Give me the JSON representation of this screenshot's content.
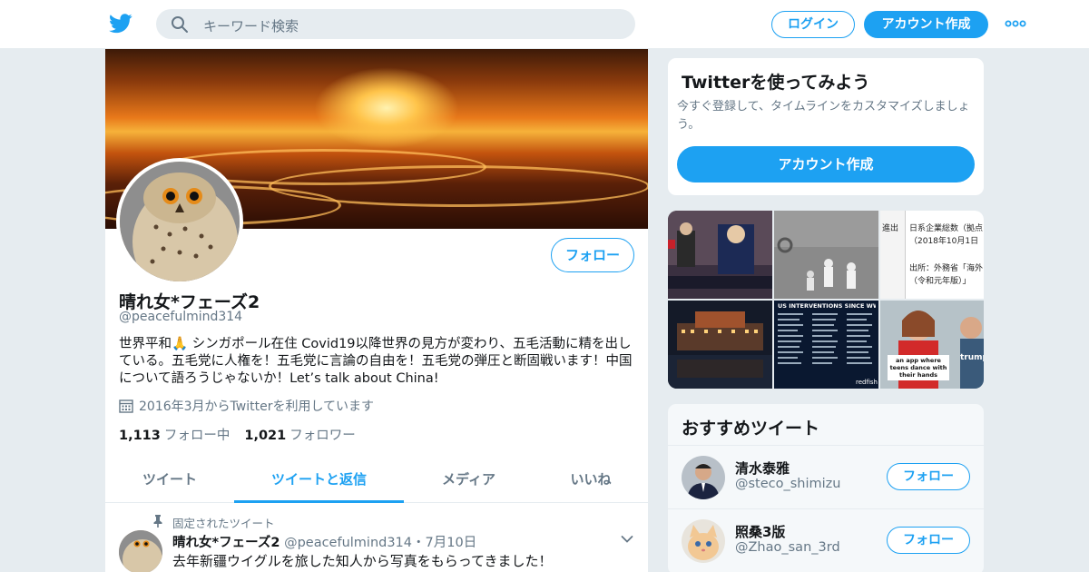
{
  "header": {
    "search_placeholder": "キーワード検索",
    "login_label": "ログイン",
    "signup_label": "アカウント作成",
    "logo_icon": "twitter-bird-icon",
    "more_icon": "more-dots-icon",
    "accent_color": "#1da1f2"
  },
  "profile": {
    "name": "晴れ女*フェーズ2",
    "handle": "@peacefulmind314",
    "follow_label": "フォロー",
    "bio": "世界平和🙏 シンガポール在住 Covid19以降世界の見方が変わり、五毛活動に精を出している。五毛党に人権を！五毛党に言論の自由を！五毛党の弾圧と断固戦います！中国について語ろうじゃないか！Let’s talk about China!",
    "joined": "2016年3月からTwitterを利用しています",
    "following_count": "1,113",
    "following_label": "フォロー中",
    "followers_count": "1,021",
    "followers_label": "フォロワー"
  },
  "tabs": [
    {
      "label": "ツイート"
    },
    {
      "label": "ツイートと返信"
    },
    {
      "label": "メディア"
    },
    {
      "label": "いいね"
    }
  ],
  "active_tab": "ツイートと返信",
  "pinned_tweet": {
    "pinned_label": "固定されたツイート",
    "author_name": "晴れ女*フェーズ2",
    "author_handle": "@peacefulmind314",
    "separator": "・",
    "date": "7月10日",
    "text": "去年新疆ウイグルを旅した知人から写真をもらってきました！"
  },
  "signup_card": {
    "title": "Twitterを使ってみよう",
    "description": "今すぐ登録して、タイムラインをカスタマイズしましょう。",
    "button_label": "アカウント作成"
  },
  "media_tiles": {
    "tile3_lines": [
      "進出",
      "日系企業総数（拠点",
      "（2018年10月1日",
      "出所：外務省「海外",
      "（令和元年版）」"
    ],
    "tile5_header": "US INTERVENTIONS SINCE WWII",
    "tile5_footer": "redfish",
    "tile6_caption": "an app where teens dance with their hands",
    "tile6_side": "trump"
  },
  "recommended": {
    "title": "おすすめツイート",
    "users": [
      {
        "name": "清水泰雅",
        "handle": "@steco_shimizu",
        "follow_label": "フォロー"
      },
      {
        "name": "照桑3版",
        "handle": "@Zhao_san_3rd",
        "follow_label": "フォロー"
      }
    ]
  }
}
